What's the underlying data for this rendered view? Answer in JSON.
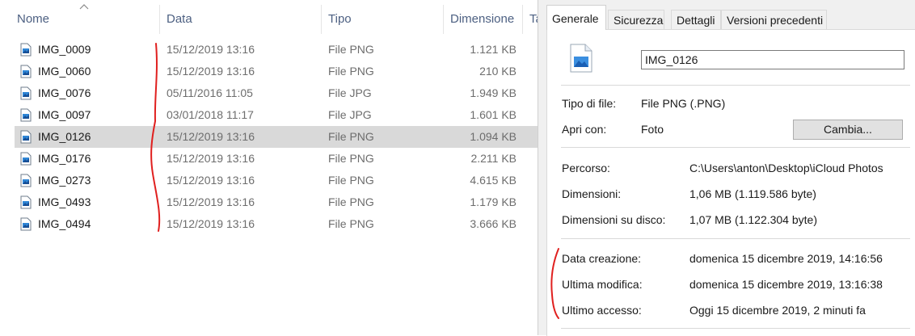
{
  "columns": {
    "name": "Nome",
    "date": "Data",
    "type": "Tipo",
    "size": "Dimensione",
    "tags": "Ta"
  },
  "files": [
    {
      "name": "IMG_0009",
      "date": "15/12/2019 13:16",
      "type": "File PNG",
      "size": "1.121 KB"
    },
    {
      "name": "IMG_0060",
      "date": "15/12/2019 13:16",
      "type": "File PNG",
      "size": "210 KB"
    },
    {
      "name": "IMG_0076",
      "date": "05/11/2016 11:05",
      "type": "File JPG",
      "size": "1.949 KB"
    },
    {
      "name": "IMG_0097",
      "date": "03/01/2018 11:17",
      "type": "File JPG",
      "size": "1.601 KB"
    },
    {
      "name": "IMG_0126",
      "date": "15/12/2019 13:16",
      "type": "File PNG",
      "size": "1.094 KB"
    },
    {
      "name": "IMG_0176",
      "date": "15/12/2019 13:16",
      "type": "File PNG",
      "size": "2.211 KB"
    },
    {
      "name": "IMG_0273",
      "date": "15/12/2019 13:16",
      "type": "File PNG",
      "size": "4.615 KB"
    },
    {
      "name": "IMG_0493",
      "date": "15/12/2019 13:16",
      "type": "File PNG",
      "size": "1.179 KB"
    },
    {
      "name": "IMG_0494",
      "date": "15/12/2019 13:16",
      "type": "File PNG",
      "size": "3.666 KB"
    }
  ],
  "selected_file": "IMG_0126",
  "tabs": [
    "Generale",
    "Sicurezza",
    "Dettagli",
    "Versioni precedenti"
  ],
  "properties": {
    "filename": "IMG_0126",
    "file_type_label": "Tipo di file:",
    "file_type_value": "File PNG (.PNG)",
    "open_with_label": "Apri con:",
    "open_with_value": "Foto",
    "change_button": "Cambia...",
    "path_label": "Percorso:",
    "path_value": "C:\\Users\\anton\\Desktop\\iCloud Photos",
    "size_label": "Dimensioni:",
    "size_value": "1,06 MB (1.119.586 byte)",
    "disk_size_label": "Dimensioni su disco:",
    "disk_size_value": "1,07 MB (1.122.304 byte)",
    "created_label": "Data creazione:",
    "created_value": "domenica 15 dicembre 2019, 14:16:56",
    "modified_label": "Ultima modifica:",
    "modified_value": "domenica 15 dicembre 2019, 13:16:38",
    "accessed_label": "Ultimo accesso:",
    "accessed_value": "Oggi 15 dicembre 2019, 2 minuti fa"
  },
  "colors": {
    "selection": "#d9d9d9",
    "header_text": "#4d6082",
    "annotation": "#e0201f"
  },
  "icons": {
    "file": "png-file-icon",
    "sort": "sort-ascending-icon"
  }
}
